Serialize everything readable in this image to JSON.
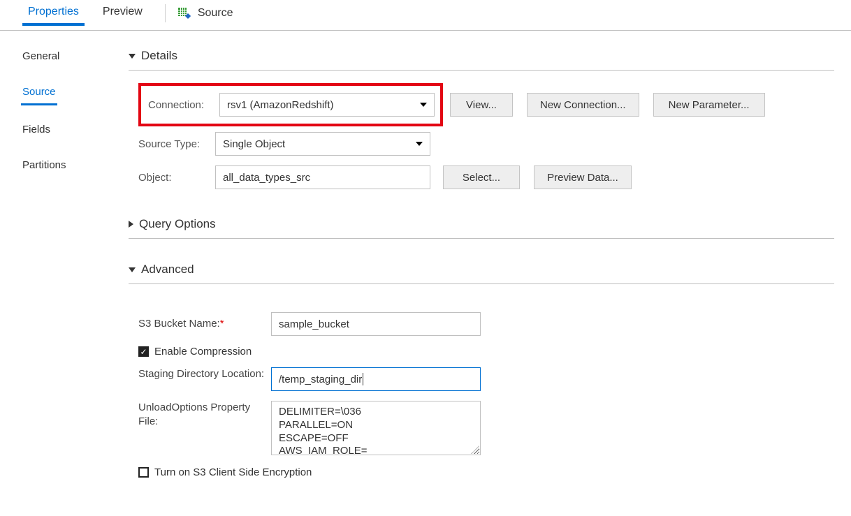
{
  "topbar": {
    "tabs": [
      "Properties",
      "Preview"
    ],
    "active_index": 0,
    "crumb_label": "Source"
  },
  "side_tabs": {
    "items": [
      "General",
      "Source",
      "Fields",
      "Partitions"
    ],
    "active_index": 1
  },
  "sections": {
    "details": {
      "title": "Details",
      "connection": {
        "label": "Connection:",
        "value": "rsv1 (AmazonRedshift)",
        "buttons": {
          "view": "View...",
          "new_connection": "New Connection...",
          "new_parameter": "New Parameter..."
        }
      },
      "source_type": {
        "label": "Source Type:",
        "value": "Single Object"
      },
      "object": {
        "label": "Object:",
        "value": "all_data_types_src",
        "buttons": {
          "select": "Select...",
          "preview": "Preview Data..."
        }
      }
    },
    "query_options": {
      "title": "Query Options"
    },
    "advanced": {
      "title": "Advanced",
      "s3_bucket": {
        "label": "S3 Bucket Name:",
        "value": "sample_bucket"
      },
      "enable_compression": {
        "label": "Enable Compression",
        "checked": true
      },
      "staging_dir": {
        "label": "Staging Directory Location:",
        "value": "/temp_staging_dir"
      },
      "unload_options": {
        "label": "UnloadOptions Property File:",
        "value": "DELIMITER=\\036\nPARALLEL=ON\nESCAPE=OFF\nAWS_IAM_ROLE="
      },
      "s3_client_encrypt": {
        "label": "Turn on S3 Client Side Encryption",
        "checked": false
      }
    }
  }
}
